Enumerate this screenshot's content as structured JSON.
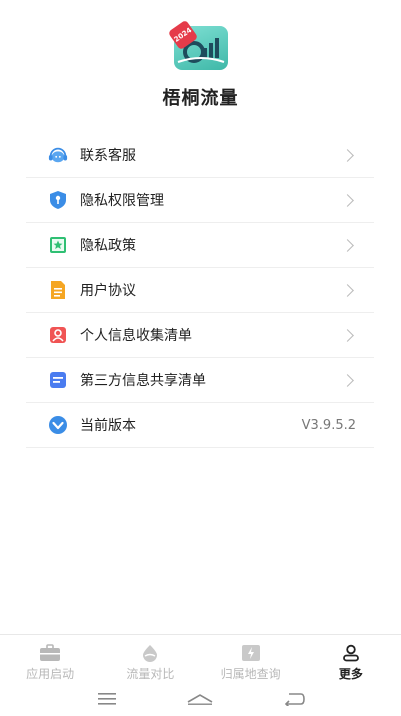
{
  "header": {
    "app_name": "梧桐流量",
    "logo_badge": "2024"
  },
  "menu": [
    {
      "label": "联系客服",
      "icon": "headset-icon",
      "color": "#3b8de6"
    },
    {
      "label": "隐私权限管理",
      "icon": "shield-icon",
      "color": "#3b8de6"
    },
    {
      "label": "隐私政策",
      "icon": "star-doc-icon",
      "color": "#2fbf73"
    },
    {
      "label": "用户协议",
      "icon": "document-icon",
      "color": "#f5a623"
    },
    {
      "label": "个人信息收集清单",
      "icon": "person-card-icon",
      "color": "#f05454"
    },
    {
      "label": "第三方信息共享清单",
      "icon": "list-icon",
      "color": "#4a7cf0"
    },
    {
      "label": "当前版本",
      "icon": "version-check-icon",
      "color": "#3b8de6",
      "value": "V3.9.5.2"
    }
  ],
  "bottom_nav": [
    {
      "label": "应用启动",
      "icon": "briefcase-icon",
      "active": false
    },
    {
      "label": "流量对比",
      "icon": "droplet-icon",
      "active": false
    },
    {
      "label": "归属地查询",
      "icon": "location-card-icon",
      "active": false
    },
    {
      "label": "更多",
      "icon": "person-icon",
      "active": true
    }
  ],
  "system_nav": [
    "menu-icon",
    "home-icon",
    "back-icon"
  ],
  "colors": {
    "inactive_tab": "#b8b8b8",
    "active_tab": "#222222",
    "divider": "#eeeeee"
  }
}
